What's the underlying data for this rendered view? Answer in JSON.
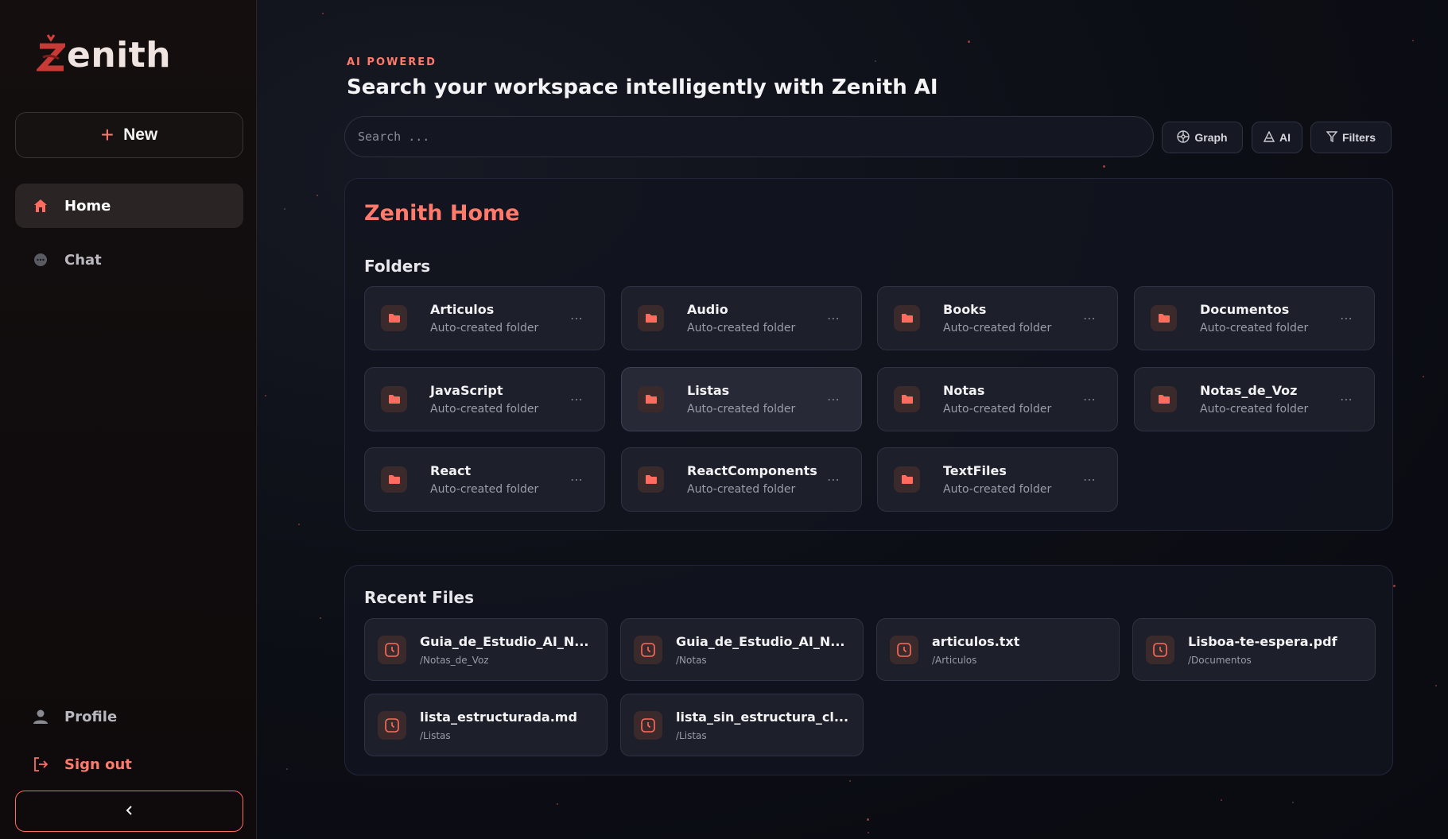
{
  "brand": {
    "logo_text": "enith",
    "accent": "#ff6b5e"
  },
  "sidebar": {
    "new_label": "New",
    "nav": {
      "home": "Home",
      "chat": "Chat"
    },
    "profile": "Profile",
    "sign_out": "Sign out"
  },
  "header": {
    "kicker": "AI POWERED",
    "title": "Search your workspace intelligently with Zenith AI"
  },
  "search": {
    "placeholder": "Search ..."
  },
  "toolbar": {
    "graph": "Graph",
    "ai": "AI",
    "filters": "Filters"
  },
  "home": {
    "title": "Zenith Home",
    "folders_title": "Folders",
    "folders": [
      {
        "name": "Articulos",
        "sub": "Auto-created folder"
      },
      {
        "name": "Audio",
        "sub": "Auto-created folder"
      },
      {
        "name": "Books",
        "sub": "Auto-created folder"
      },
      {
        "name": "Documentos",
        "sub": "Auto-created folder"
      },
      {
        "name": "JavaScript",
        "sub": "Auto-created folder"
      },
      {
        "name": "Listas",
        "sub": "Auto-created folder"
      },
      {
        "name": "Notas",
        "sub": "Auto-created folder"
      },
      {
        "name": "Notas_de_Voz",
        "sub": "Auto-created folder"
      },
      {
        "name": "React",
        "sub": "Auto-created folder"
      },
      {
        "name": "ReactComponents",
        "sub": "Auto-created folder"
      },
      {
        "name": "TextFiles",
        "sub": "Auto-created folder"
      }
    ]
  },
  "recent": {
    "title": "Recent Files",
    "files": [
      {
        "name": "Guia_de_Estudio_AI_N...",
        "path": "/Notas_de_Voz"
      },
      {
        "name": "Guia_de_Estudio_AI_N...",
        "path": "/Notas"
      },
      {
        "name": "articulos.txt",
        "path": "/Articulos"
      },
      {
        "name": "Lisboa-te-espera.pdf",
        "path": "/Documentos"
      },
      {
        "name": "lista_estructurada.md",
        "path": "/Listas"
      },
      {
        "name": "lista_sin_estructura_cl...",
        "path": "/Listas"
      }
    ]
  },
  "icons": {
    "new": "plus-icon",
    "home": "home-icon",
    "chat": "chat-bubble-icon",
    "profile": "user-icon",
    "sign_out": "logout-icon",
    "collapse": "chevron-left-icon",
    "graph": "graph-icon",
    "ai": "ai-icon",
    "filters": "filter-icon",
    "folder": "folder-icon",
    "file": "clock-icon",
    "more": "more-horizontal-icon"
  }
}
